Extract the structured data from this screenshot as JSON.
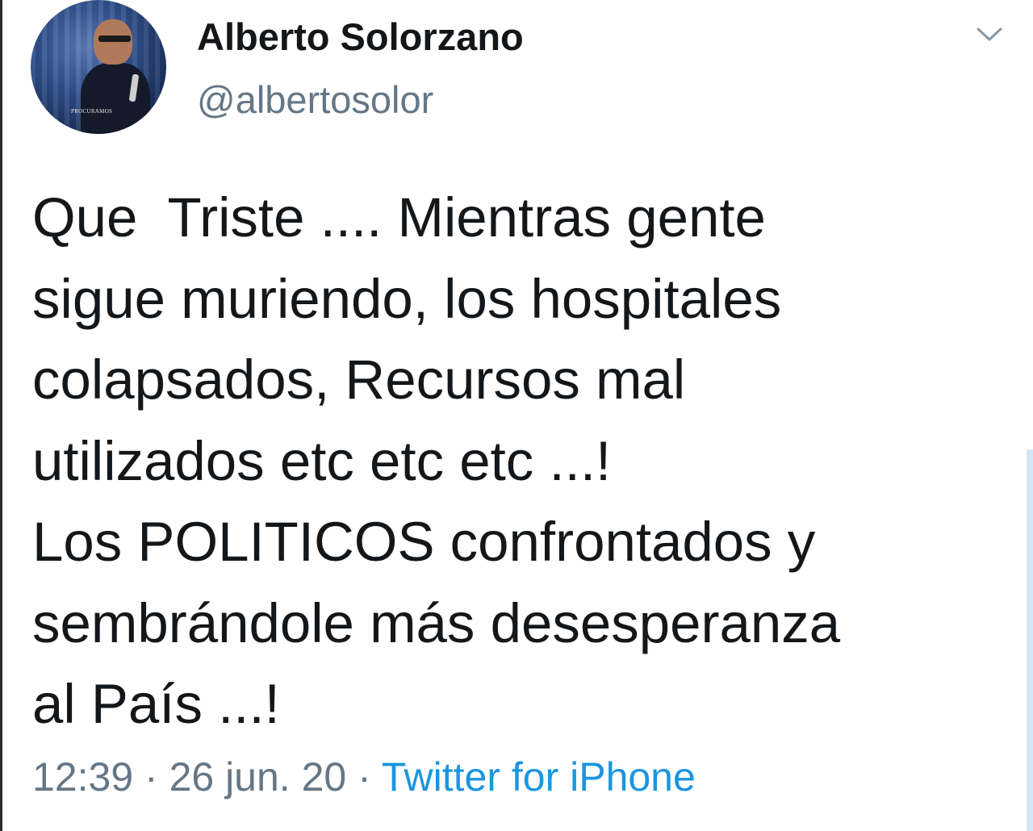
{
  "author": {
    "name": "Alberto Solorzano",
    "handle": "@albertosolor",
    "avatar_logo_text": "PROCURAMOS"
  },
  "tweet": {
    "lines": [
      "Que  Triste .... Mientras gente",
      "sigue muriendo, los hospitales",
      "colapsados, Recursos mal",
      "utilizados etc etc etc ...!",
      "Los POLITICOS confrontados y",
      "sembrándole más desesperanza",
      "al País ...!"
    ],
    "time": "12:39",
    "separator": " · ",
    "date": "26 jun. 20",
    "source": "Twitter for iPhone"
  },
  "icons": {
    "menu": "chevron-down-icon"
  },
  "colors": {
    "text": "#14171a",
    "secondary": "#657786",
    "link": "#1b95e0",
    "background": "#ffffff"
  }
}
